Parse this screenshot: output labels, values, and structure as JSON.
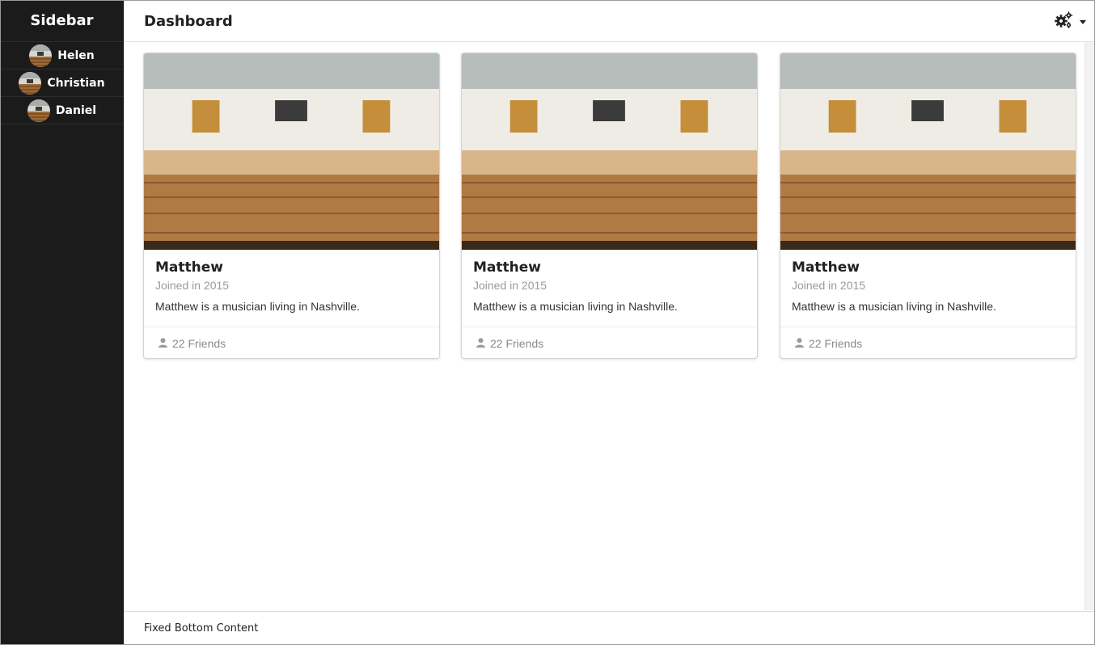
{
  "sidebar": {
    "title": "Sidebar",
    "items": [
      {
        "label": "Helen"
      },
      {
        "label": "Christian"
      },
      {
        "label": "Daniel"
      }
    ]
  },
  "header": {
    "title": "Dashboard",
    "settings_icon": "gears-icon",
    "dropdown_icon": "caret-down-icon"
  },
  "cards": [
    {
      "name": "Matthew",
      "meta": "Joined in 2015",
      "description": "Matthew is a musician living in Nashville.",
      "friends": "22 Friends"
    },
    {
      "name": "Matthew",
      "meta": "Joined in 2015",
      "description": "Matthew is a musician living in Nashville.",
      "friends": "22 Friends"
    },
    {
      "name": "Matthew",
      "meta": "Joined in 2015",
      "description": "Matthew is a musician living in Nashville.",
      "friends": "22 Friends"
    }
  ],
  "footer": {
    "text": "Fixed Bottom Content"
  },
  "colors": {
    "sidebar_bg": "#1b1b1b",
    "chair": "#b98a55",
    "wall": "#f1efe8",
    "muted_text": "#9a9a9a"
  }
}
